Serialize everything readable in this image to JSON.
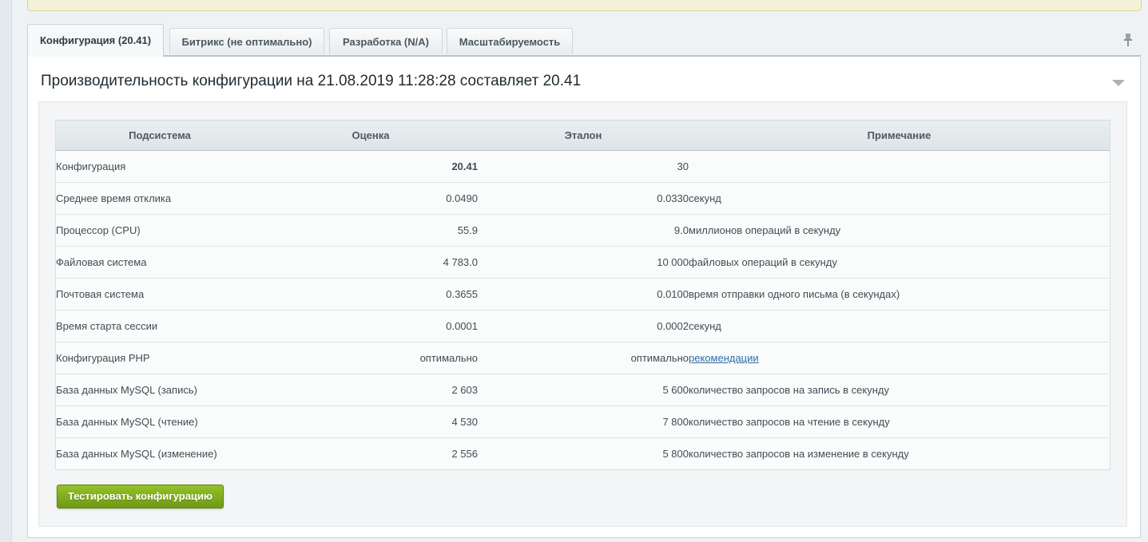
{
  "tabs": [
    {
      "label": "Конфигурация (20.41)",
      "active": true
    },
    {
      "label": "Битрикс (не оптимально)",
      "active": false
    },
    {
      "label": "Разработка (N/A)",
      "active": false
    },
    {
      "label": "Масштабируемость",
      "active": false
    }
  ],
  "panel": {
    "title": "Производительность конфигурации на 21.08.2019 11:28:28 составляет 20.41"
  },
  "table": {
    "headers": [
      "Подсистема",
      "Оценка",
      "Эталон",
      "Примечание"
    ],
    "rows": [
      {
        "name": "Конфигурация",
        "score": "20.41",
        "reference": "30",
        "note": ""
      },
      {
        "name": "Среднее время отклика",
        "score": "0.0490",
        "reference": "0.0330",
        "note": "секунд"
      },
      {
        "name": "Процессор (CPU)",
        "score": "55.9",
        "reference": "9.0",
        "note": "миллионов операций в секунду"
      },
      {
        "name": "Файловая система",
        "score": "4 783.0",
        "reference": "10 000",
        "note": "файловых операций в секунду"
      },
      {
        "name": "Почтовая система",
        "score": "0.3655",
        "reference": "0.0100",
        "note": "время отправки одного письма (в секундах)"
      },
      {
        "name": "Время старта сессии",
        "score": "0.0001",
        "reference": "0.0002",
        "note": "секунд"
      },
      {
        "name": "Конфигурация PHP",
        "score": "оптимально",
        "reference": "оптимально",
        "note": "рекомендации"
      },
      {
        "name": "База данных MySQL (запись)",
        "score": "2 603",
        "reference": "5 600",
        "note": "количество запросов на запись в секунду"
      },
      {
        "name": "База данных MySQL (чтение)",
        "score": "4 530",
        "reference": "7 800",
        "note": "количество запросов на чтение в секунду"
      },
      {
        "name": "База данных MySQL (изменение)",
        "score": "2 556",
        "reference": "5 800",
        "note": "количество запросов на изменение в секунду"
      }
    ]
  },
  "buttons": {
    "test_label": "Тестировать конфигурацию"
  },
  "icons": {
    "pin": "pin-icon",
    "collapse": "chevron-down-icon"
  },
  "colors": {
    "accent_green": "#7fae1c",
    "link": "#2e6ca8"
  }
}
